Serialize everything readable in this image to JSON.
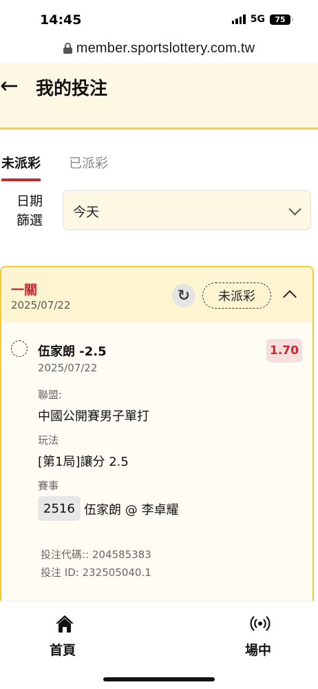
{
  "status_bar": {
    "time": "14:45",
    "network": "5G",
    "battery": "75"
  },
  "browser": {
    "url": "member.sportslottery.com.tw"
  },
  "header": {
    "title": "我的投注"
  },
  "tabs": [
    {
      "label": "未派彩",
      "active": true
    },
    {
      "label": "已派彩",
      "active": false
    }
  ],
  "filter": {
    "label": "日期篩選",
    "value": "今天"
  },
  "bet": {
    "type": "一關",
    "date": "2025/07/22",
    "status": "未派彩",
    "selection": "伍家朗 -2.5",
    "odds": "1.70",
    "selection_date": "2025/07/22",
    "league_label": "聯盟:",
    "league": "中國公開賽男子單打",
    "market_label": "玩法",
    "market": "[第1局]讓分 2.5",
    "event_label": "賽事",
    "event_code": "2516",
    "event_name": "伍家朗 @ 李卓耀",
    "ticket_code": "投注代碼:: 204585383",
    "ticket_id": "投注 ID: 232505040.1"
  },
  "bottom_nav": [
    {
      "label": "首頁",
      "icon": "home-icon"
    },
    {
      "label": "場中",
      "icon": "live-broadcast-icon"
    }
  ],
  "colors": {
    "accent_red": "#c8282e",
    "header_bg": "#fdf8e4",
    "border_yellow": "#f2cf3c"
  }
}
